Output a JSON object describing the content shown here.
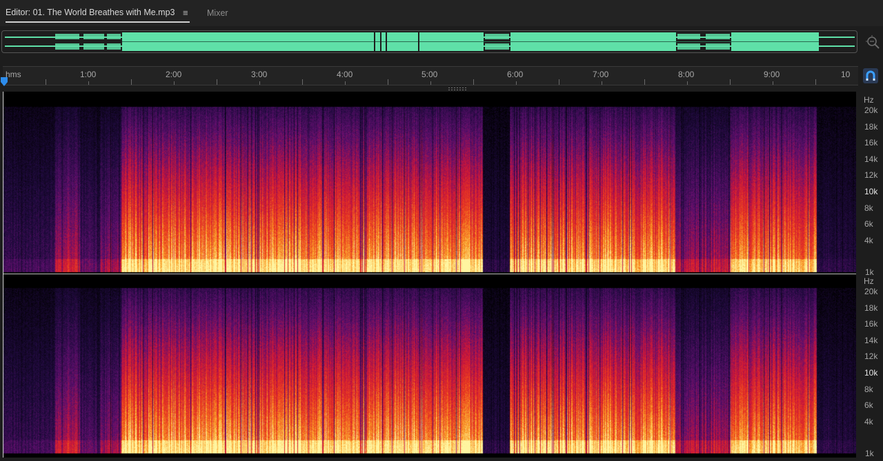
{
  "tabs": {
    "editor_label": "Editor: 01. The World Breathes with Me.mp3",
    "menu_glyph": "≡",
    "mixer_label": "Mixer"
  },
  "icons": {
    "zoom": "zoom-selection-icon",
    "snap": "snap-magnet-icon",
    "playhead": "playhead-marker-icon"
  },
  "colors": {
    "waveform": "#5fe0a8",
    "accent": "#2d8ceb"
  },
  "ruler": {
    "unit_label": "hms",
    "labels": [
      "1:00",
      "2:00",
      "3:00",
      "4:00",
      "5:00",
      "6:00",
      "7:00",
      "8:00",
      "9:00",
      "10"
    ]
  },
  "frequency_axis": {
    "channel_top": {
      "unit": "Hz",
      "labels": [
        "20k",
        "18k",
        "16k",
        "14k",
        "12k",
        "10k",
        "8k",
        "6k",
        "4k",
        "1k"
      ]
    },
    "channel_bottom": {
      "unit": "Hz",
      "labels": [
        "20k",
        "18k",
        "16k",
        "14k",
        "12k",
        "10k",
        "8k",
        "6k",
        "4k",
        "1k"
      ]
    }
  }
}
